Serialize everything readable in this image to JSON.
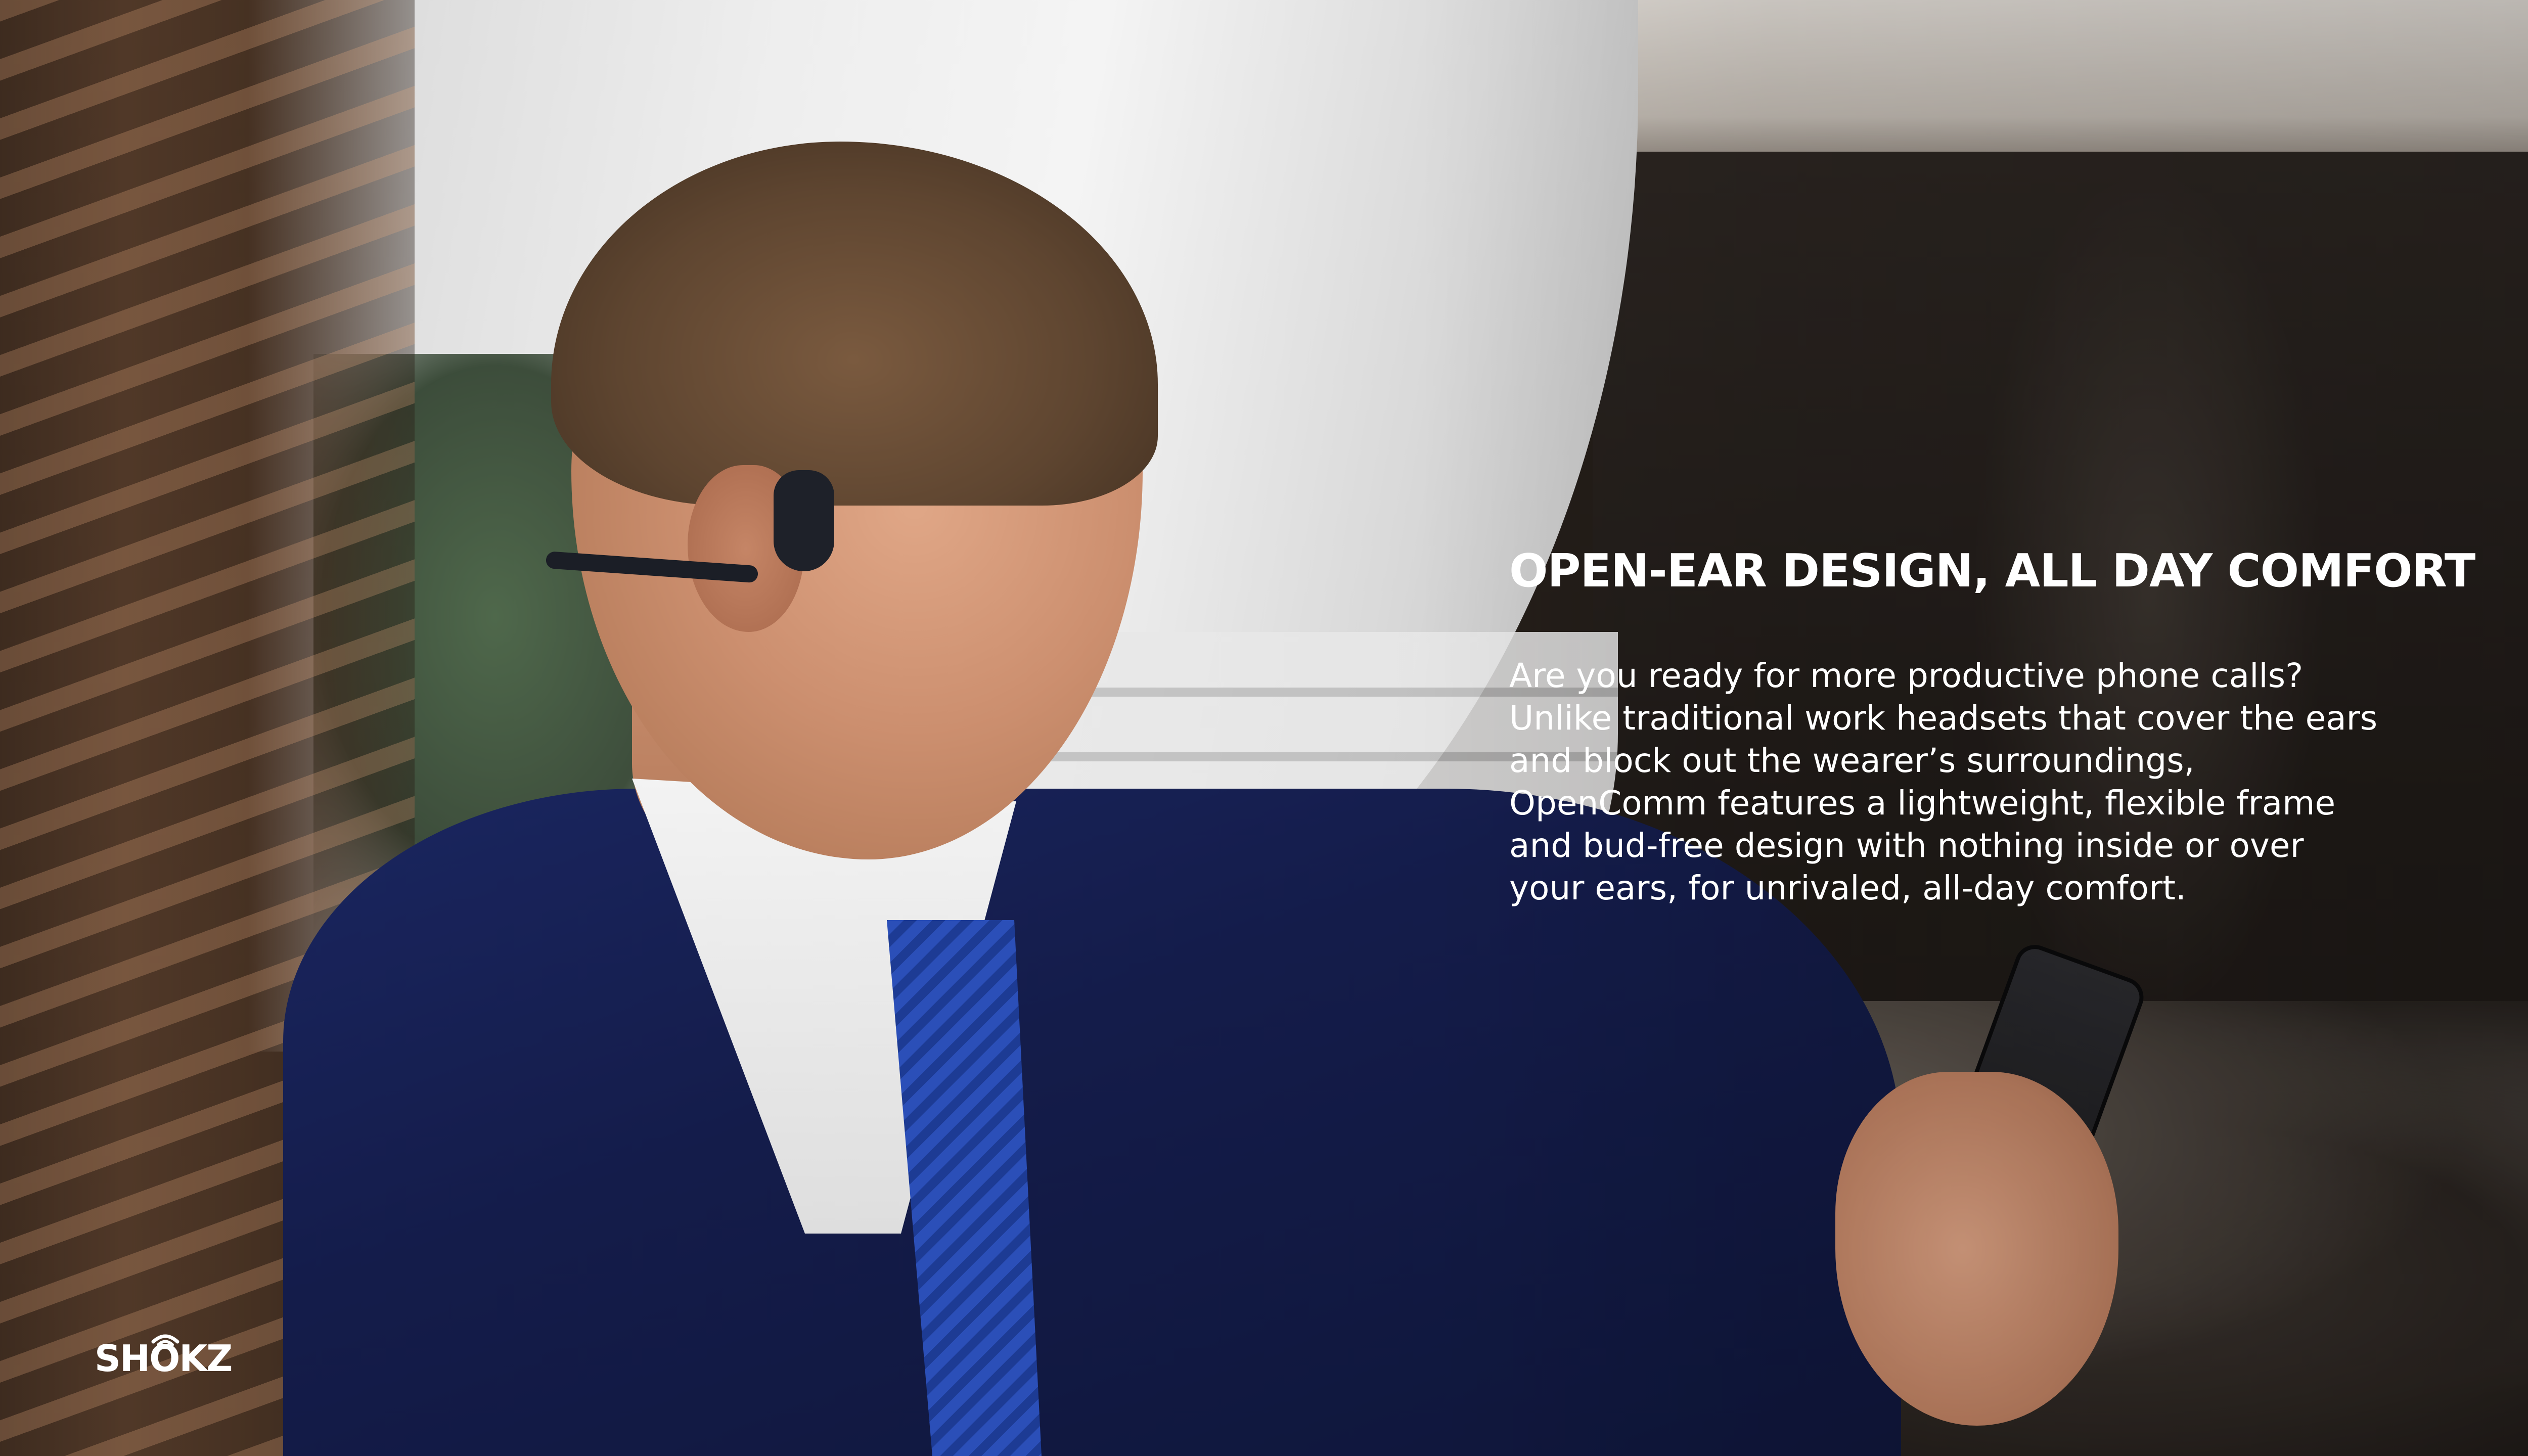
{
  "hero": {
    "headline": "OPEN-EAR DESIGN, ALL DAY COMFORT",
    "body_lines": [
      "Are you ready for more productive phone calls?",
      "Unlike traditional work headsets that cover the ears",
      "and block out the wearer’s surroundings,",
      "OpenComm features a lightweight, flexible frame",
      "and bud-free design with nothing inside or over",
      "your ears, for unrivaled, all-day comfort."
    ],
    "text_color": "#ffffff"
  },
  "brand": {
    "logo_text": "SHOKZ",
    "logo_color": "#ffffff"
  },
  "scene": {
    "photo_subject": "man-in-suit-wearing-headset-looking-at-phone",
    "jacket_color": "#141c4a",
    "tie_color": "#2b4fb8"
  }
}
